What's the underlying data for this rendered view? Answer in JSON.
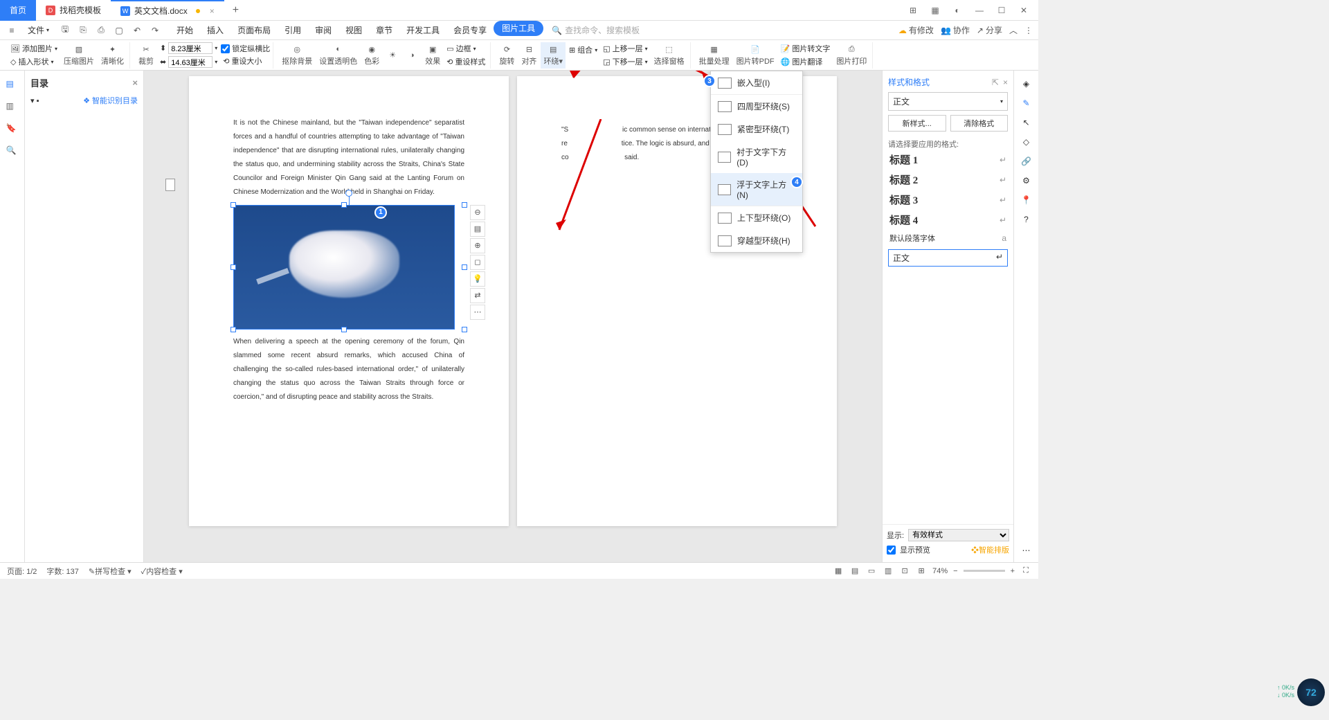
{
  "titlebar": {
    "home": "首页",
    "tab1": "找稻壳模板",
    "tab2": "英文文档.docx"
  },
  "menubar": {
    "file": "文件",
    "tabs": [
      "开始",
      "插入",
      "页面布局",
      "引用",
      "审阅",
      "视图",
      "章节",
      "开发工具",
      "会员专享",
      "图片工具"
    ],
    "search_placeholder": "查找命令、搜索模板",
    "right": {
      "unsaved": "有修改",
      "coop": "协作",
      "share": "分享"
    }
  },
  "toolbar": {
    "add_image": "添加图片",
    "insert_shape": "插入形状",
    "compress": "压缩图片",
    "ocr": "清晰化",
    "crop": "裁剪",
    "width": "8.23厘米",
    "height": "14.63厘米",
    "lock_ratio": "锁定纵横比",
    "reset_size": "重设大小",
    "remove_bg": "抠除背景",
    "transparency": "设置透明色",
    "color": "色彩",
    "effect": "效果",
    "border": "边框",
    "reset_style": "重设样式",
    "rotate": "旋转",
    "align": "对齐",
    "wrap": "环绕",
    "group": "组合",
    "up": "上移一层",
    "down": "下移一层",
    "select_pane": "选择窗格",
    "batch": "批量处理",
    "to_pdf": "图片转PDF",
    "to_text": "图片转文字",
    "translate": "图片翻译",
    "print": "图片打印"
  },
  "outline": {
    "title": "目录",
    "smart": "智能识别目录"
  },
  "wrap_menu": {
    "items": [
      {
        "label": "嵌入型(I)"
      },
      {
        "label": "四周型环绕(S)"
      },
      {
        "label": "紧密型环绕(T)"
      },
      {
        "label": "衬于文字下方(D)"
      },
      {
        "label": "浮于文字上方(N)"
      },
      {
        "label": "上下型环绕(O)"
      },
      {
        "label": "穿越型环绕(H)"
      }
    ]
  },
  "doc": {
    "p1": "It is not the Chinese mainland, but the \"Taiwan independence\" separatist forces and a handful of countries attempting to take advantage of \"Taiwan independence\" that are disrupting international rules, unilaterally changing the status quo, and undermining stability across the Straits, China's State Councilor and Foreign Minister Qin Gang said at the Lanting Forum on Chinese Modernization and the World held in Shanghai on Friday.",
    "p2": "When delivering a speech at the opening ceremony of the forum, Qin slammed some recent absurd remarks, which accused China of challenging the so-called rules-based international order,\" of unilaterally changing the status quo across the Taiwan Straits through force or coercion,\" and of disrupting peace and stability across the Straits.",
    "p3a": "\"S",
    "p3b": "ic common sense on international re",
    "p3c": "tice. The logic is absurd, and the co",
    "p3d": " said."
  },
  "style_panel": {
    "title": "样式和格式",
    "current": "正文",
    "new_style": "新样式...",
    "clear": "清除格式",
    "apply_label": "请选择要应用的格式:",
    "styles": [
      "标题 1",
      "标题 2",
      "标题 3",
      "标题 4"
    ],
    "default_font": "默认段落字体",
    "body": "正文",
    "show": "显示:",
    "show_val": "有效样式",
    "preview": "显示预览",
    "smart": "智能排版"
  },
  "statusbar": {
    "page": "页面: 1/2",
    "words": "字数: 137",
    "spell": "拼写检查",
    "content": "内容检查",
    "zoom": "74%"
  },
  "perf": {
    "val": "72",
    "l1": "0K/s",
    "l2": "0K/s"
  }
}
